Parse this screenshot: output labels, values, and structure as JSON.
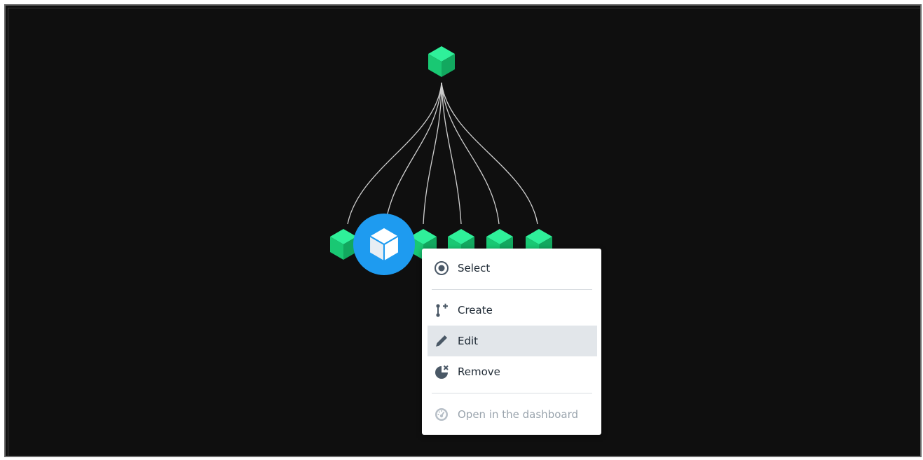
{
  "graph": {
    "root_node_icon": "cube-icon",
    "child_node_icon": "cube-icon",
    "selected_node_icon": "cube-icon",
    "node_color": "#23dc87",
    "selected_color": "#1e9bf0",
    "edge_color": "#cfcfcf",
    "child_count": 6,
    "selected_index": 1
  },
  "context_menu": {
    "items": [
      {
        "label": "Select",
        "icon": "radio-target-icon"
      },
      {
        "label": "Create",
        "icon": "branch-add-icon"
      },
      {
        "label": "Edit",
        "icon": "pencil-icon"
      },
      {
        "label": "Remove",
        "icon": "pie-remove-icon"
      },
      {
        "label": "Open in the dashboard",
        "icon": "dashboard-gauge-icon"
      }
    ],
    "highlighted": "Edit",
    "disabled": [
      "Open in the dashboard"
    ]
  }
}
